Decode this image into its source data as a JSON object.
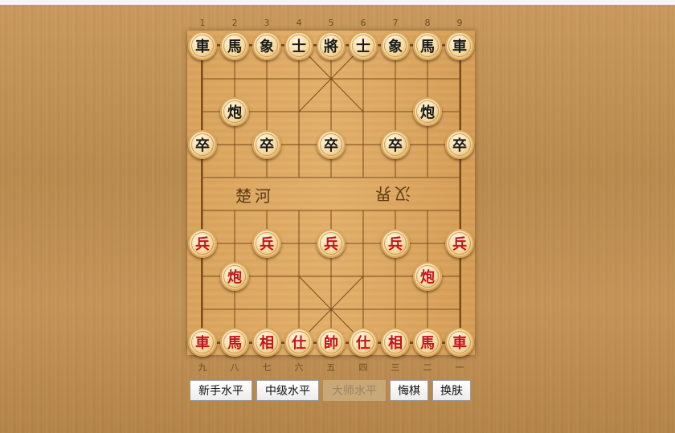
{
  "board": {
    "top_numbers": [
      "1",
      "2",
      "3",
      "4",
      "5",
      "6",
      "7",
      "8",
      "9"
    ],
    "bottom_numbers": [
      "九",
      "八",
      "七",
      "六",
      "五",
      "四",
      "三",
      "二",
      "一"
    ],
    "river_left": "楚河",
    "river_right": "汉界"
  },
  "pieces": [
    {
      "side": "black",
      "label": "車",
      "file": 0,
      "rank": 0
    },
    {
      "side": "black",
      "label": "馬",
      "file": 1,
      "rank": 0
    },
    {
      "side": "black",
      "label": "象",
      "file": 2,
      "rank": 0
    },
    {
      "side": "black",
      "label": "士",
      "file": 3,
      "rank": 0
    },
    {
      "side": "black",
      "label": "將",
      "file": 4,
      "rank": 0
    },
    {
      "side": "black",
      "label": "士",
      "file": 5,
      "rank": 0
    },
    {
      "side": "black",
      "label": "象",
      "file": 6,
      "rank": 0
    },
    {
      "side": "black",
      "label": "馬",
      "file": 7,
      "rank": 0
    },
    {
      "side": "black",
      "label": "車",
      "file": 8,
      "rank": 0
    },
    {
      "side": "black",
      "label": "炮",
      "file": 1,
      "rank": 2
    },
    {
      "side": "black",
      "label": "炮",
      "file": 7,
      "rank": 2
    },
    {
      "side": "black",
      "label": "卒",
      "file": 0,
      "rank": 3
    },
    {
      "side": "black",
      "label": "卒",
      "file": 2,
      "rank": 3
    },
    {
      "side": "black",
      "label": "卒",
      "file": 4,
      "rank": 3
    },
    {
      "side": "black",
      "label": "卒",
      "file": 6,
      "rank": 3
    },
    {
      "side": "black",
      "label": "卒",
      "file": 8,
      "rank": 3
    },
    {
      "side": "red",
      "label": "兵",
      "file": 0,
      "rank": 6
    },
    {
      "side": "red",
      "label": "兵",
      "file": 2,
      "rank": 6
    },
    {
      "side": "red",
      "label": "兵",
      "file": 4,
      "rank": 6
    },
    {
      "side": "red",
      "label": "兵",
      "file": 6,
      "rank": 6
    },
    {
      "side": "red",
      "label": "兵",
      "file": 8,
      "rank": 6
    },
    {
      "side": "red",
      "label": "炮",
      "file": 1,
      "rank": 7
    },
    {
      "side": "red",
      "label": "炮",
      "file": 7,
      "rank": 7
    },
    {
      "side": "red",
      "label": "車",
      "file": 0,
      "rank": 9
    },
    {
      "side": "red",
      "label": "馬",
      "file": 1,
      "rank": 9
    },
    {
      "side": "red",
      "label": "相",
      "file": 2,
      "rank": 9
    },
    {
      "side": "red",
      "label": "仕",
      "file": 3,
      "rank": 9
    },
    {
      "side": "red",
      "label": "帥",
      "file": 4,
      "rank": 9
    },
    {
      "side": "red",
      "label": "仕",
      "file": 5,
      "rank": 9
    },
    {
      "side": "red",
      "label": "相",
      "file": 6,
      "rank": 9
    },
    {
      "side": "red",
      "label": "馬",
      "file": 7,
      "rank": 9
    },
    {
      "side": "red",
      "label": "車",
      "file": 8,
      "rank": 9
    }
  ],
  "buttons": {
    "novice": "新手水平",
    "intermediate": "中级水平",
    "master": "大师水平",
    "undo": "悔棋",
    "skin": "换肤"
  },
  "colors": {
    "red_piece_text": "#c3131b",
    "black_piece_text": "#1a1a1a",
    "board_line": "#7a4a1a"
  }
}
